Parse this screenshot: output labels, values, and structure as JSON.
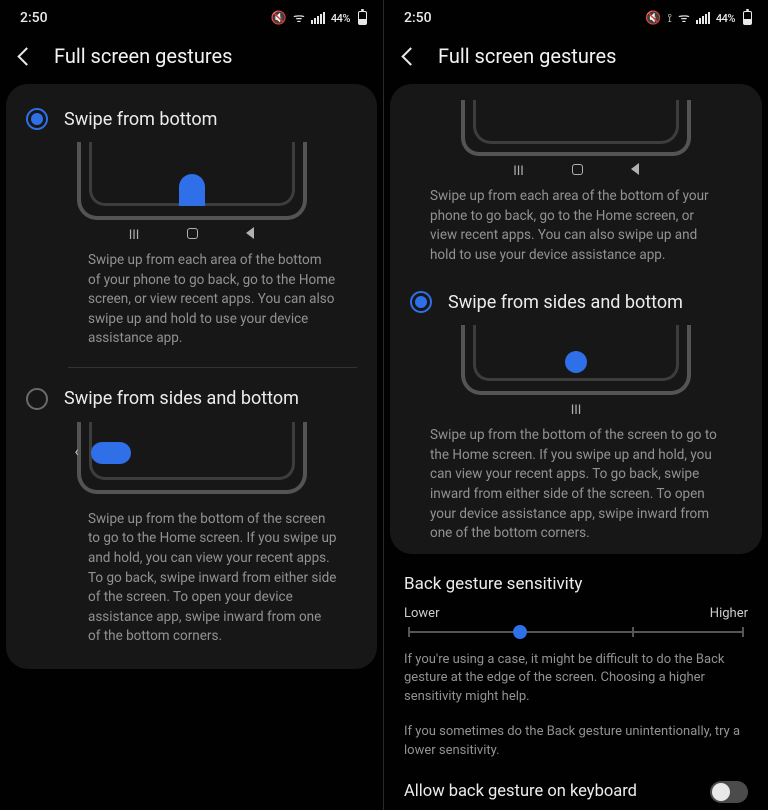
{
  "status": {
    "time": "2:50",
    "battery_pct": "44%"
  },
  "screen_title": "Full screen gestures",
  "option_bottom": {
    "label": "Swipe from bottom",
    "desc": "Swipe up from each area of the bottom of your phone to go back, go to the Home screen, or view recent apps. You can also swipe up and hold to use your device assistance app."
  },
  "option_sides": {
    "label": "Swipe from sides and bottom",
    "desc": "Swipe up from the bottom of the screen to go to the Home screen. If you swipe up and hold, you can view your recent apps. To go back, swipe inward from either side of the screen. To open your device assistance app, swipe inward from one of the bottom corners."
  },
  "sensitivity": {
    "title": "Back gesture sensitivity",
    "low": "Lower",
    "high": "Higher",
    "desc1": "If you're using a case, it might be difficult to do the Back gesture at the edge of the screen. Choosing a higher sensitivity might help.",
    "desc2": "If you sometimes do the Back gesture unintentionally, try a lower sensitivity."
  },
  "toggle_kb": {
    "label": "Allow back gesture on keyboard"
  }
}
